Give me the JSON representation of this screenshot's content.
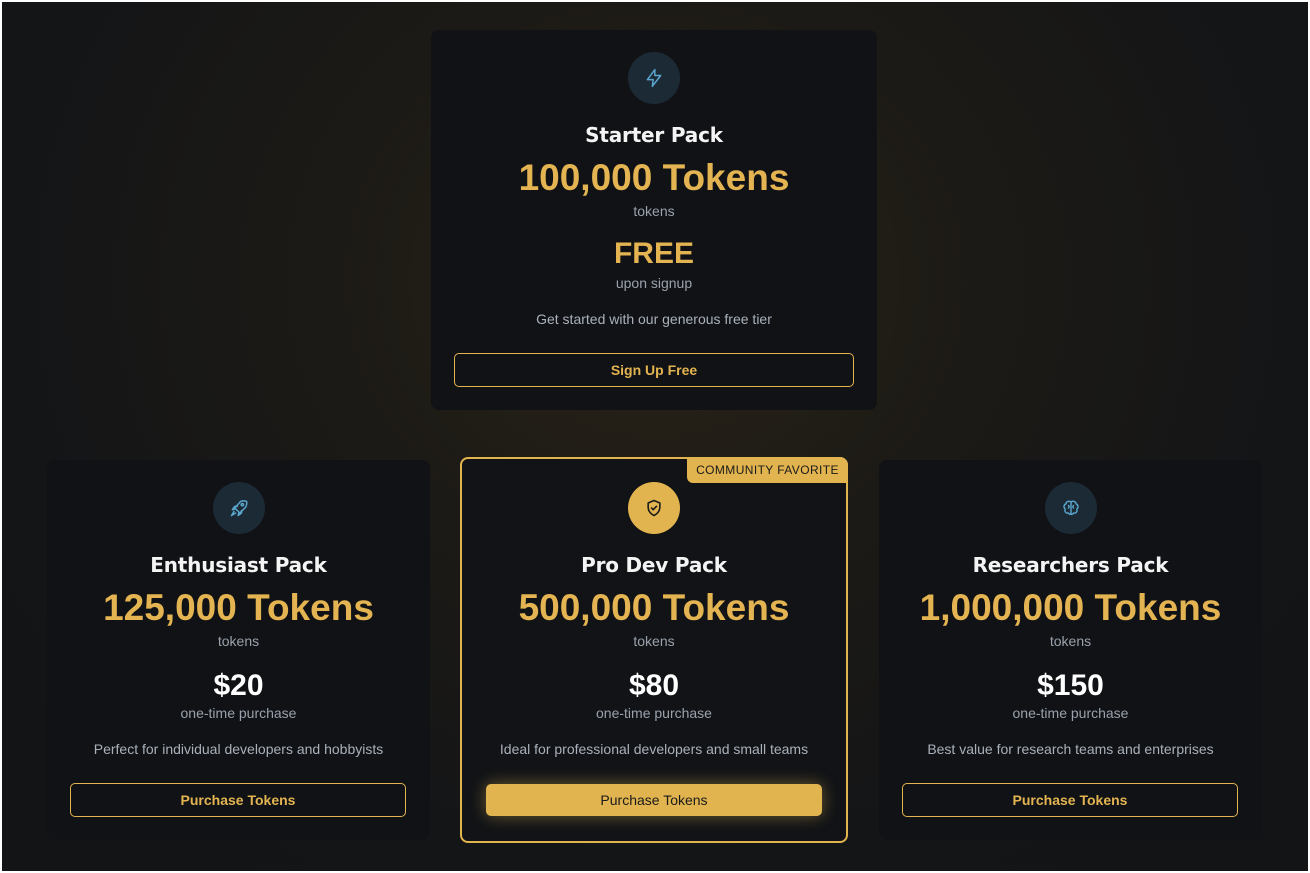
{
  "colors": {
    "accent": "#e1b44f",
    "card_bg": "#101215",
    "icon_bg": "#1c2a36",
    "muted_text": "#9aa2ad"
  },
  "starter": {
    "icon": "lightning-icon",
    "title": "Starter Pack",
    "tokens": "100,000 Tokens",
    "tokens_unit": "tokens",
    "price": "FREE",
    "price_note": "upon signup",
    "description": "Get started with our generous free tier",
    "button_label": "Sign Up Free"
  },
  "enthusiast": {
    "icon": "rocket-icon",
    "title": "Enthusiast Pack",
    "tokens": "125,000 Tokens",
    "tokens_unit": "tokens",
    "price": "$20",
    "price_note": "one-time purchase",
    "description": "Perfect for individual developers and hobbyists",
    "button_label": "Purchase Tokens"
  },
  "pro": {
    "badge": "COMMUNITY FAVORITE",
    "icon": "shield-check-icon",
    "title": "Pro Dev Pack",
    "tokens": "500,000 Tokens",
    "tokens_unit": "tokens",
    "price": "$80",
    "price_note": "one-time purchase",
    "description": "Ideal for professional developers and small teams",
    "button_label": "Purchase Tokens"
  },
  "researchers": {
    "icon": "brain-icon",
    "title": "Researchers Pack",
    "tokens": "1,000,000 Tokens",
    "tokens_unit": "tokens",
    "price": "$150",
    "price_note": "one-time purchase",
    "description": "Best value for research teams and enterprises",
    "button_label": "Purchase Tokens"
  }
}
